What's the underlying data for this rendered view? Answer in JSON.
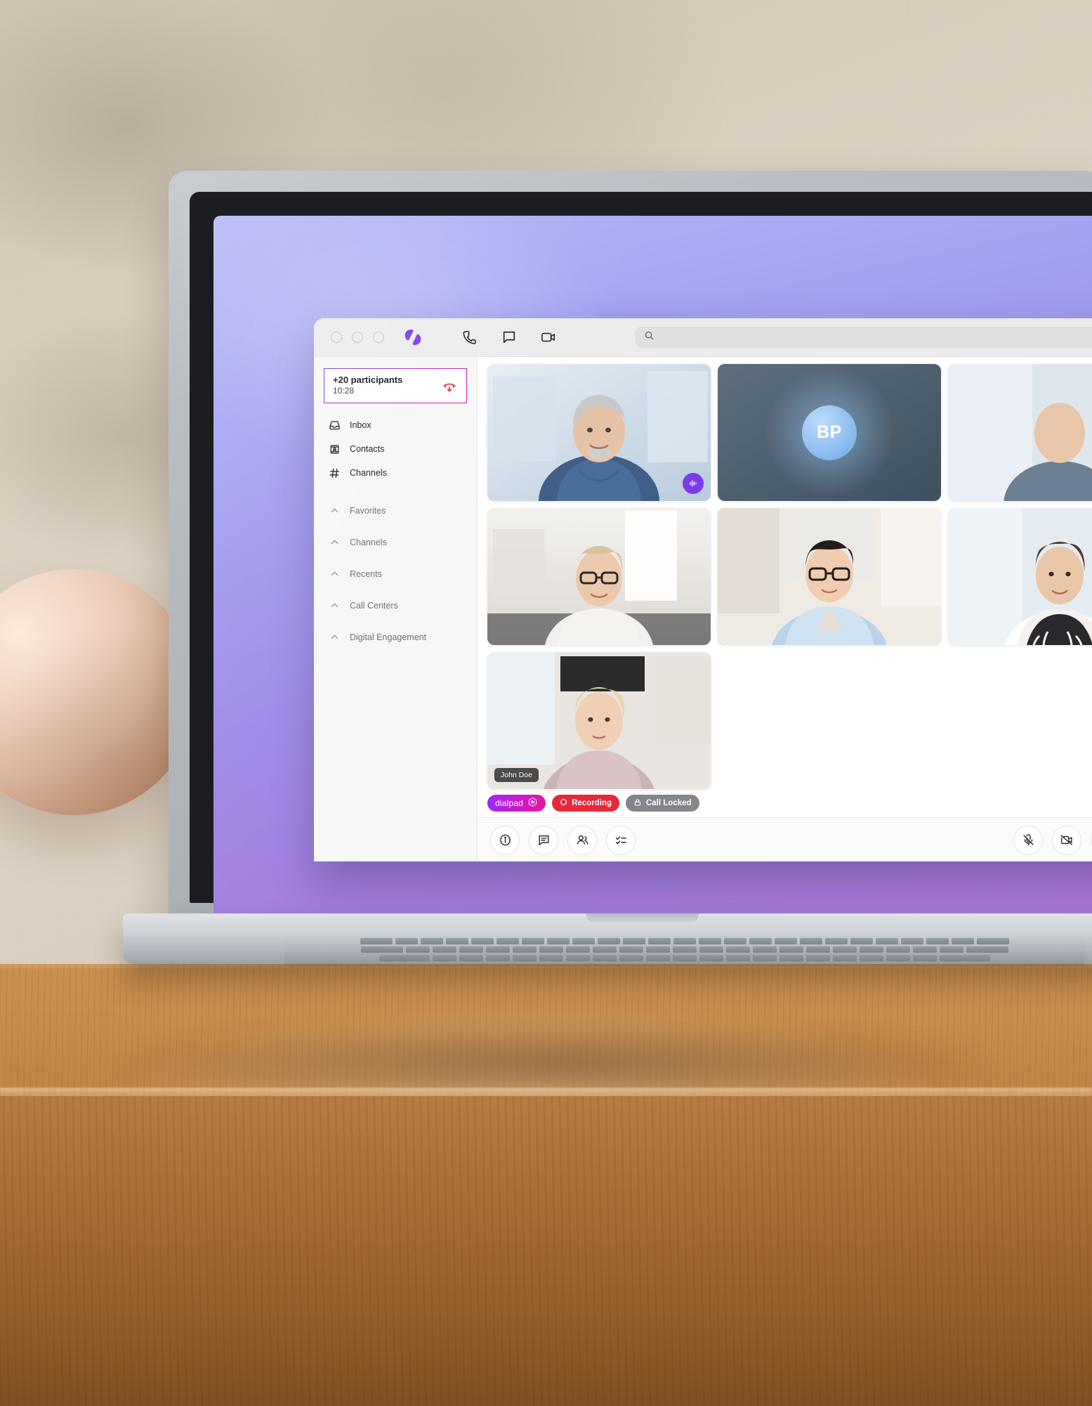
{
  "scene": {
    "description": "Laptop on wooden desk showing Dialpad video meeting app",
    "wallpaper_colors": [
      "#b3b4f7",
      "#9b86e6",
      "#a877d6"
    ]
  },
  "window": {
    "traffic_lights": [
      "close",
      "minimize",
      "maximize"
    ],
    "brand_logo": "dialpad-logo",
    "toolbar_icons": [
      "phone-icon",
      "message-icon",
      "video-icon"
    ],
    "search": {
      "placeholder": "",
      "value": "",
      "icon": "search-icon"
    }
  },
  "sidebar": {
    "active_call": {
      "title": "+20 participants",
      "duration": "10:28",
      "hangup_icon": "hangup-icon"
    },
    "nav": [
      {
        "label": "Inbox",
        "icon": "inbox-icon"
      },
      {
        "label": "Contacts",
        "icon": "contacts-icon"
      },
      {
        "label": "Channels",
        "icon": "hash-icon"
      }
    ],
    "sections": [
      {
        "label": "Favorites",
        "icon": "chevron-up-icon"
      },
      {
        "label": "Channels",
        "icon": "chevron-up-icon"
      },
      {
        "label": "Recents",
        "icon": "chevron-up-icon"
      },
      {
        "label": "Call Centers",
        "icon": "chevron-up-icon"
      },
      {
        "label": "Digital Engagement",
        "icon": "chevron-up-icon"
      }
    ]
  },
  "meeting": {
    "tiles": [
      {
        "id": "tile-1",
        "type": "video",
        "name": "",
        "mic": "speaking",
        "active": false,
        "show_name": false
      },
      {
        "id": "tile-2",
        "type": "initials",
        "name": "",
        "initials": "BP",
        "mic": "none",
        "active": false,
        "show_name": false
      },
      {
        "id": "tile-3",
        "type": "video",
        "name": "",
        "mic": "none",
        "active": false,
        "show_name": false
      },
      {
        "id": "tile-4",
        "type": "video",
        "name": "",
        "mic": "none",
        "active": true,
        "show_name": false
      },
      {
        "id": "tile-5",
        "type": "video",
        "name": "",
        "mic": "muted",
        "active": false,
        "show_name": false
      },
      {
        "id": "tile-6",
        "type": "video",
        "name": "John Doe",
        "mic": "none",
        "active": false,
        "show_name": true
      }
    ],
    "status_badges": [
      {
        "label": "dialpad",
        "kind": "dialpad",
        "icon": "ai-hexagon-icon"
      },
      {
        "label": "Recording",
        "kind": "recording",
        "icon": "record-circle-icon"
      },
      {
        "label": "Call Locked",
        "kind": "locked",
        "icon": "lock-icon"
      }
    ],
    "toolbar_left": [
      {
        "name": "meeting-info-button",
        "icon": "info-icon"
      },
      {
        "name": "meeting-chat-button",
        "icon": "chat-icon"
      },
      {
        "name": "participants-button",
        "icon": "people-icon"
      },
      {
        "name": "checklist-button",
        "icon": "checklist-icon"
      }
    ],
    "toolbar_right": [
      {
        "name": "mic-toggle-button",
        "icon": "mic-off-icon"
      },
      {
        "name": "camera-toggle-button",
        "icon": "video-off-icon"
      },
      {
        "name": "share-screen-button",
        "icon": "screen-share-icon"
      },
      {
        "name": "more-options-button",
        "icon": "more-icon"
      }
    ]
  }
}
